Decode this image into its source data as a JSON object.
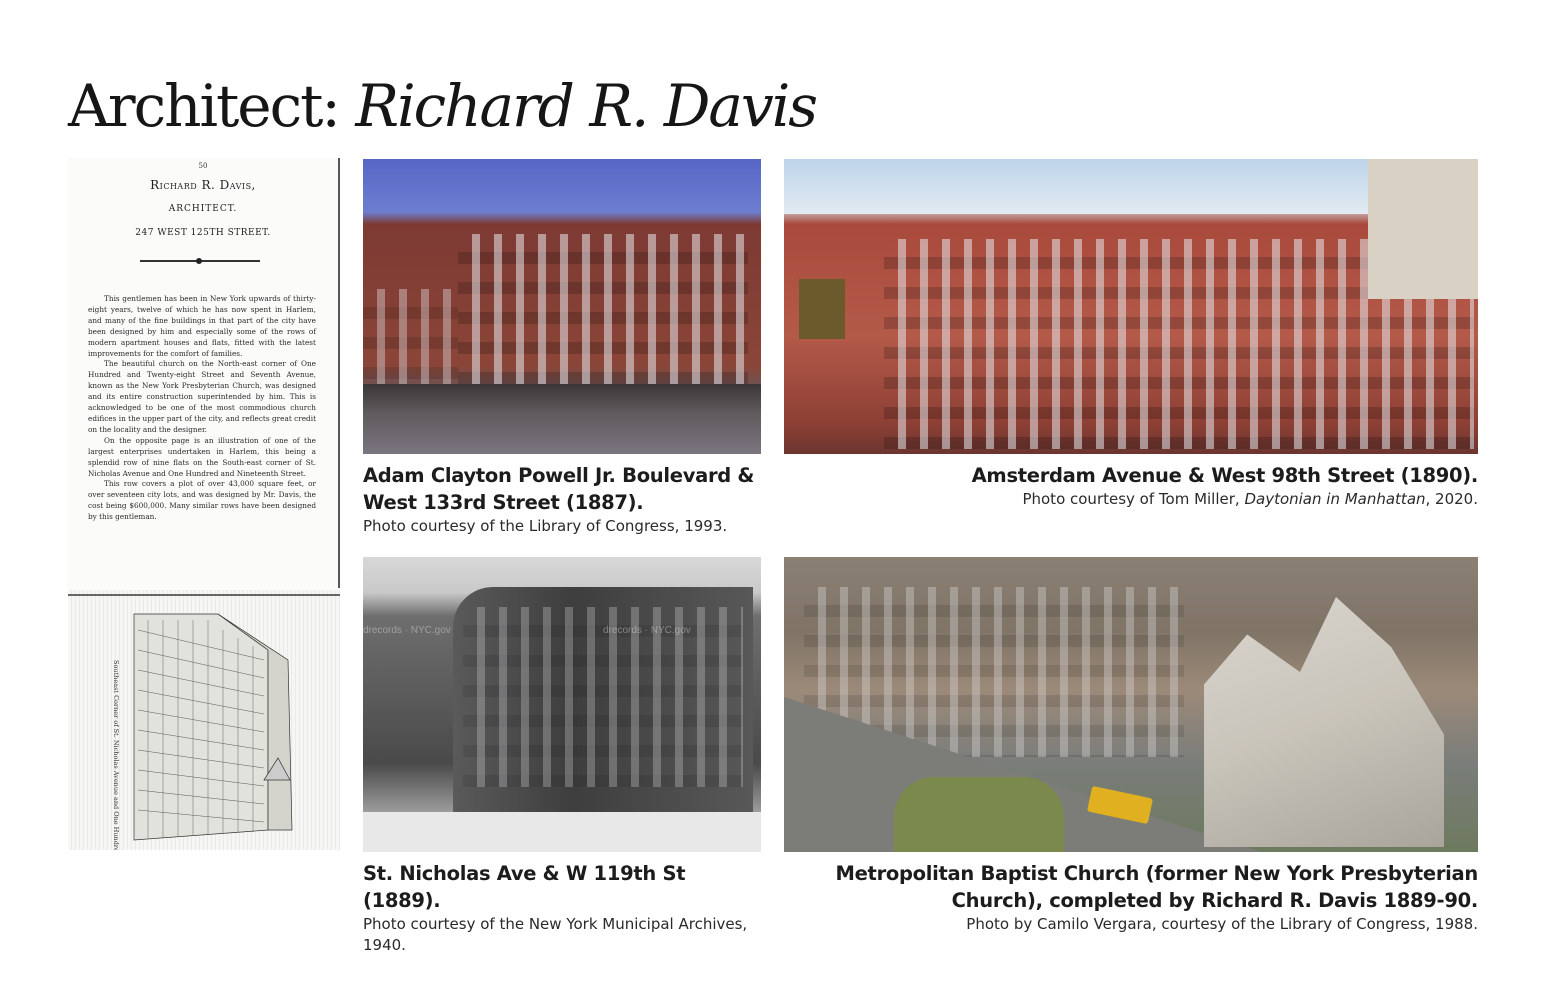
{
  "title": {
    "prefix": "Architect: ",
    "name": "Richard R. Davis"
  },
  "scan": {
    "page_number": "50",
    "heading_name": "Richard R. Davis,",
    "heading_role": "ARCHITECT.",
    "heading_address": "247 WEST 125TH STREET.",
    "paragraphs": [
      "This gentlemen has been in New York upwards of thirty-eight years, twelve of which he has now spent in Harlem, and many of the fine buildings in that part of the city have been designed by him and especially some of the rows of modern apartment houses and flats, fitted with the latest improvements for the comfort of families.",
      "The beautiful church on the North-east corner of One Hundred and Twenty-eight Street and Seventh Avenue, known as the New York Presbyterian Church, was designed and its entire construction superintended by him. This is acknowledged to be one of the most commodious church edifices in the upper part of the city, and reflects great credit on the locality and the designer.",
      "On the opposite page is an illustration of one of the largest enterprises undertaken in Harlem, this being a splendid row of nine flats on the South-east corner of St. Nicholas Avenue and One Hundred and Nineteenth Street.",
      "This row covers a plot of over 43,000 square feet, or over seventeen city lots, and was designed by Mr. Davis, the cost being $600,000. Many similar rows have been designed by this gentleman."
    ],
    "illustration_caption": "Southeast Corner of St. Nicholas Avenue and One Hundred"
  },
  "photos": [
    {
      "title": "Adam Clayton Powell Jr. Boulevard & West 133rd Street (1887).",
      "credit": "Photo courtesy of the Library of Congress, 1993."
    },
    {
      "title": "Amsterdam Avenue & West 98th Street (1890).",
      "credit_prefix": "Photo courtesy of Tom Miller, ",
      "credit_italic": "Daytonian in Manhattan",
      "credit_suffix": ", 2020."
    },
    {
      "title": "St. Nicholas Ave & W 119th St (1889).",
      "credit": "Photo courtesy of the New York Municipal Archives, 1940.",
      "watermark": "drecords · NYC.gov"
    },
    {
      "title": "Metropolitan Baptist Church (former New York Presbyterian Church), completed by Richard R. Davis 1889-90.",
      "credit": "Photo by Camilo Vergara, courtesy of the Library of Congress, 1988."
    }
  ]
}
